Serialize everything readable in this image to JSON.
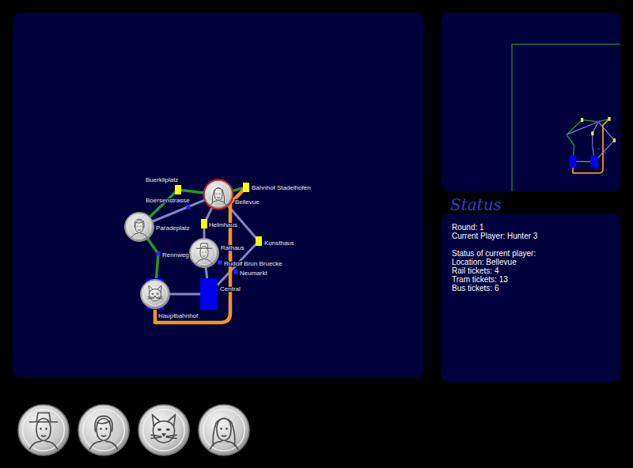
{
  "map": {
    "stations": [
      {
        "name": "Paradeplatz",
        "kind": "tram"
      },
      {
        "name": "Buerkliplatz",
        "kind": "bus"
      },
      {
        "name": "Boersenstrasse",
        "kind": "tram"
      },
      {
        "name": "Bellevue",
        "kind": "tram"
      },
      {
        "name": "Bahnhof Stadelhofen",
        "kind": "bus"
      },
      {
        "name": "Helmhaus",
        "kind": "bus"
      },
      {
        "name": "Rathaus",
        "kind": "tram"
      },
      {
        "name": "Rudolf Brun Bruecke",
        "kind": "tram"
      },
      {
        "name": "Neumarkt",
        "kind": "tram"
      },
      {
        "name": "Kunsthaus",
        "kind": "bus"
      },
      {
        "name": "Rennweg",
        "kind": "tram"
      },
      {
        "name": "Central",
        "kind": "rail"
      },
      {
        "name": "Hauptbahnhof",
        "kind": "rail"
      }
    ],
    "connections": [
      {
        "from": "Paradeplatz",
        "to": "Bellevue",
        "kind": "tram"
      },
      {
        "from": "Bellevue",
        "to": "Kunsthaus",
        "kind": "tram"
      },
      {
        "from": "Kunsthaus",
        "to": "Central",
        "kind": "tram"
      },
      {
        "from": "Bellevue",
        "to": "Helmhaus",
        "kind": "tram"
      },
      {
        "from": "Helmhaus",
        "to": "Rathaus",
        "kind": "tram"
      },
      {
        "from": "Rathaus",
        "to": "Central",
        "kind": "tram"
      },
      {
        "from": "Central",
        "to": "Hauptbahnhof",
        "kind": "tram"
      },
      {
        "from": "Paradeplatz",
        "to": "Buerkliplatz",
        "kind": "bus"
      },
      {
        "from": "Buerkliplatz",
        "to": "Bellevue",
        "kind": "bus"
      },
      {
        "from": "Bellevue",
        "to": "Bahnhof Stadelhofen",
        "kind": "bus"
      },
      {
        "from": "Paradeplatz",
        "to": "Rennweg",
        "kind": "bus"
      },
      {
        "from": "Rennweg",
        "to": "Hauptbahnhof",
        "kind": "bus"
      },
      {
        "from": "Bahnhof Stadelhofen",
        "to": "Hauptbahnhof",
        "kind": "rail"
      }
    ],
    "tokens": [
      {
        "station": "Paradeplatz",
        "kind": "woman-short",
        "current": false
      },
      {
        "station": "Bellevue",
        "kind": "woman-long",
        "current": true
      },
      {
        "station": "Rathaus",
        "kind": "man-hat",
        "current": false
      },
      {
        "station": "Hauptbahnhof",
        "kind": "cat",
        "current": false
      }
    ]
  },
  "status": {
    "title": "Status",
    "lines": [
      "Round: 1",
      "Current Player: Hunter 3",
      "",
      "Status of current player:",
      "Location: Bellevue",
      "Rail tickets: 4",
      "Tram tickets: 13",
      "Bus tickets: 6"
    ]
  },
  "players": [
    {
      "kind": "man-hat"
    },
    {
      "kind": "woman-short"
    },
    {
      "kind": "cat"
    },
    {
      "kind": "woman-long"
    }
  ]
}
